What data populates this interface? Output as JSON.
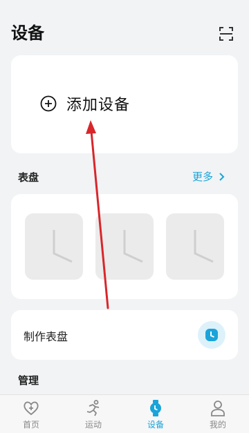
{
  "header": {
    "title": "设备",
    "scan_icon": "scan-icon"
  },
  "add_device": {
    "label": "添加设备",
    "icon": "plus-circle-icon"
  },
  "watch_faces": {
    "title": "表盘",
    "more_label": "更多",
    "more_icon": "chevron-right-icon",
    "items": [
      {
        "icon": "clock-face-icon"
      },
      {
        "icon": "clock-face-icon"
      },
      {
        "icon": "clock-face-icon"
      }
    ]
  },
  "make_watch_face": {
    "label": "制作表盘",
    "icon": "clock-icon"
  },
  "manage": {
    "title": "管理"
  },
  "tabbar": {
    "tabs": [
      {
        "label": "首页",
        "icon": "heart-plus-icon",
        "active": false
      },
      {
        "label": "运动",
        "icon": "runner-icon",
        "active": false
      },
      {
        "label": "设备",
        "icon": "watch-icon",
        "active": true
      },
      {
        "label": "我的",
        "icon": "person-icon",
        "active": false
      }
    ]
  },
  "colors": {
    "accent": "#1aa4d9",
    "background": "#f1f3f5",
    "annotation_arrow": "#d8262b"
  }
}
